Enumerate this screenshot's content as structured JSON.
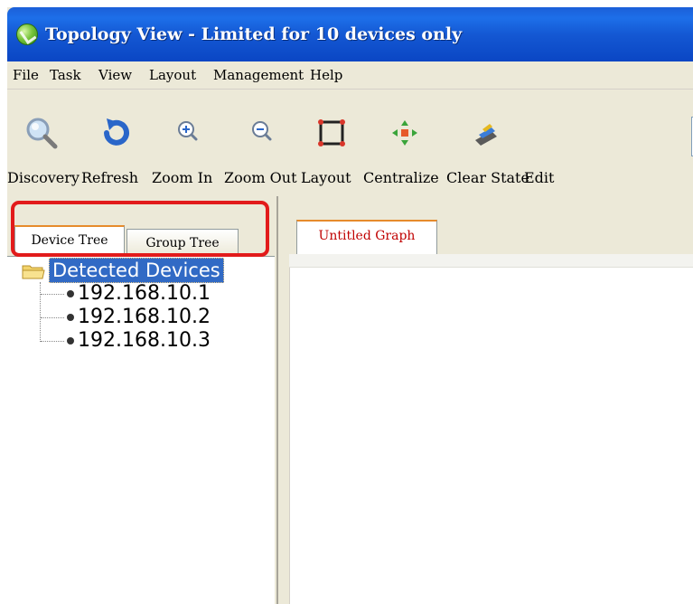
{
  "window": {
    "title": "Topology View - Limited for 10 devices only",
    "title_bar_color": "#0a46c4",
    "title_icon": "app-icon"
  },
  "menu": [
    {
      "label": "File"
    },
    {
      "label": "Task"
    },
    {
      "label": "View"
    },
    {
      "label": "Layout"
    },
    {
      "label": "Management"
    },
    {
      "label": "Help"
    }
  ],
  "toolbar": [
    {
      "label": "Discovery",
      "icon": "magnifier-icon"
    },
    {
      "label": "Refresh",
      "icon": "refresh-icon"
    },
    {
      "label": "Zoom In",
      "icon": "zoom-in-icon"
    },
    {
      "label": "Zoom Out",
      "icon": "zoom-out-icon"
    },
    {
      "label": "Layout",
      "icon": "layout-icon"
    },
    {
      "label": "Centralize",
      "icon": "centralize-icon"
    },
    {
      "label": "Clear State",
      "icon": "clear-state-icon"
    },
    {
      "label": "Edit",
      "icon": "edit-icon"
    }
  ],
  "left_panel": {
    "tabs": [
      {
        "label": "Device Tree",
        "active": true
      },
      {
        "label": "Group Tree",
        "active": false
      }
    ],
    "tree": {
      "root": "Detected Devices",
      "root_icon": "folder-icon",
      "items": [
        "192.168.10.1",
        "192.168.10.2",
        "192.168.10.3"
      ]
    }
  },
  "right_panel": {
    "tabs": [
      {
        "label": "Untitled Graph",
        "active": true
      }
    ]
  },
  "colors": {
    "highlight": "#e21b1b",
    "tab_accent": "#e68b2c",
    "selection": "#316ac5",
    "graph_tab_text": "#c00000"
  }
}
